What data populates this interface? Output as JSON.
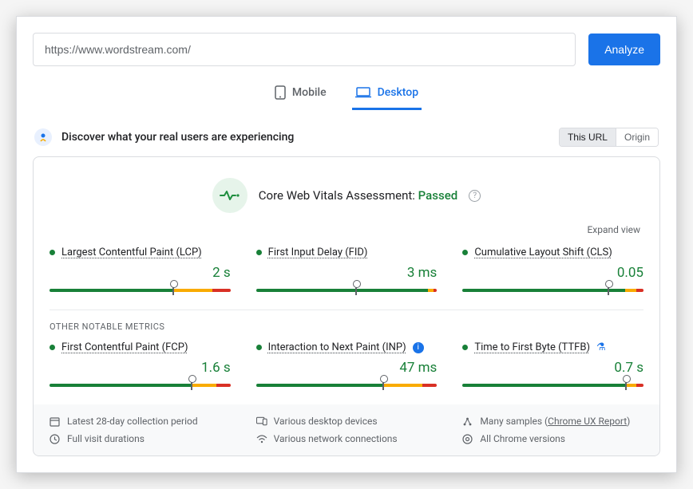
{
  "header": {
    "url_value": "https://www.wordstream.com/",
    "analyze_label": "Analyze"
  },
  "tabs": {
    "mobile": "Mobile",
    "desktop": "Desktop",
    "active": "desktop"
  },
  "discover": {
    "title": "Discover what your real users are experiencing",
    "toggle_this_url": "This URL",
    "toggle_origin": "Origin"
  },
  "assessment": {
    "prefix": "Core Web Vitals Assessment:",
    "status": "Passed",
    "expand": "Expand view"
  },
  "metrics": {
    "section_other": "OTHER NOTABLE METRICS",
    "lcp": {
      "name": "Largest Contentful Paint (LCP)",
      "value": "2 s",
      "green": 68,
      "yellow": 22,
      "red": 10,
      "marker": 68
    },
    "fid": {
      "name": "First Input Delay (FID)",
      "value": "3 ms",
      "green": 95,
      "yellow": 3,
      "red": 2,
      "marker": 55
    },
    "cls": {
      "name": "Cumulative Layout Shift (CLS)",
      "value": "0.05",
      "green": 90,
      "yellow": 6,
      "red": 4,
      "marker": 80
    },
    "fcp": {
      "name": "First Contentful Paint (FCP)",
      "value": "1.6 s",
      "green": 78,
      "yellow": 14,
      "red": 8,
      "marker": 78
    },
    "inp": {
      "name": "Interaction to Next Paint (INP)",
      "value": "47 ms",
      "green": 70,
      "yellow": 22,
      "red": 8,
      "marker": 70
    },
    "ttfb": {
      "name": "Time to First Byte (TTFB)",
      "value": "0.7 s",
      "green": 90,
      "yellow": 6,
      "red": 4,
      "marker": 90
    }
  },
  "meta": {
    "period": "Latest 28-day collection period",
    "durations": "Full visit durations",
    "devices": "Various desktop devices",
    "connections": "Various network connections",
    "samples_prefix": "Many samples",
    "samples_link": "Chrome UX Report",
    "versions": "All Chrome versions"
  }
}
